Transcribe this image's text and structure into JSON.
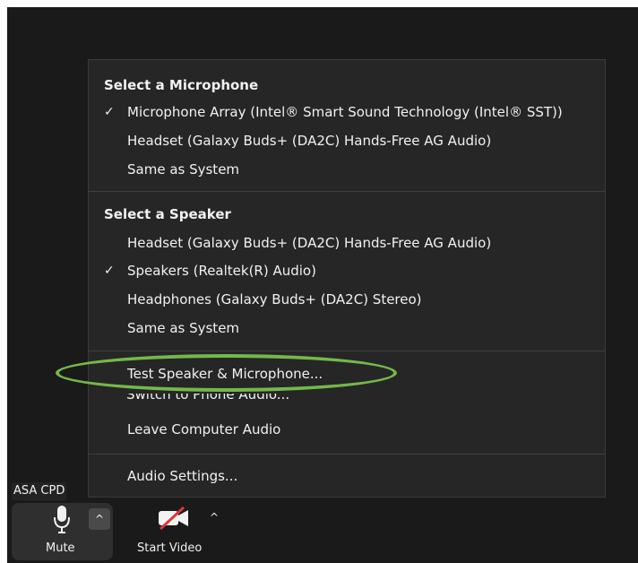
{
  "menu": {
    "microphone_section": {
      "title": "Select a Microphone",
      "items": [
        {
          "label": "Microphone Array (Intel® Smart Sound Technology (Intel® SST))",
          "checked": true
        },
        {
          "label": "Headset (Galaxy Buds+ (DA2C) Hands-Free AG Audio)",
          "checked": false
        },
        {
          "label": "Same as System",
          "checked": false
        }
      ]
    },
    "speaker_section": {
      "title": "Select a Speaker",
      "items": [
        {
          "label": "Headset (Galaxy Buds+ (DA2C) Hands-Free AG Audio)",
          "checked": false
        },
        {
          "label": "Speakers (Realtek(R) Audio)",
          "checked": true
        },
        {
          "label": "Headphones (Galaxy Buds+ (DA2C) Stereo)",
          "checked": false
        },
        {
          "label": "Same as System",
          "checked": false
        }
      ]
    },
    "actions": [
      {
        "label": "Test Speaker & Microphone..."
      },
      {
        "label": "Switch to Phone Audio..."
      },
      {
        "label": "Leave Computer Audio"
      }
    ],
    "settings": {
      "label": "Audio Settings..."
    },
    "check_glyph": "✓"
  },
  "toolbar": {
    "name_tag": "ASA CPD",
    "mute_label": "Mute",
    "video_label": "Start Video",
    "caret_glyph": "^"
  },
  "colors": {
    "menu_background": "#262626",
    "screen_background": "#1a1a1a",
    "text": "#f1f1f1",
    "highlight": "#74b84a",
    "video_slash": "#d93939"
  },
  "icons": {
    "microphone": "microphone-icon",
    "video_off": "video-off-icon",
    "caret": "caret-up-icon",
    "checkmark": "checkmark-icon"
  }
}
